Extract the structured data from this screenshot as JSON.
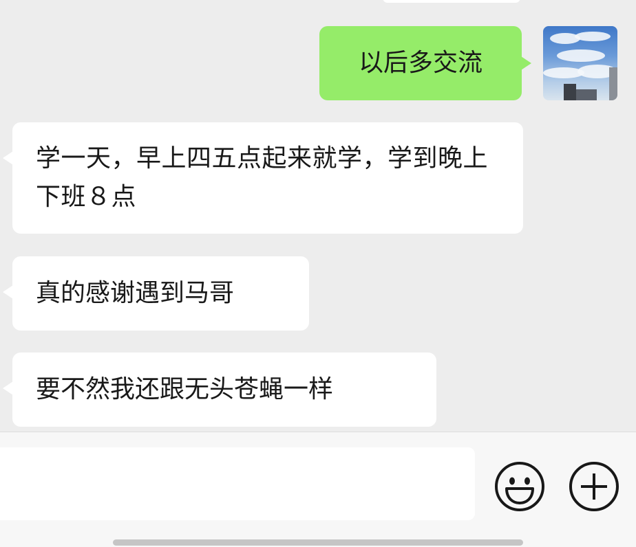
{
  "chat": {
    "messages": [
      {
        "direction": "outgoing",
        "text": "以后多交流"
      },
      {
        "direction": "incoming",
        "text": "学一天，早上四五点起来就学，学到晚上下班８点"
      },
      {
        "direction": "incoming",
        "text": "真的感谢遇到马哥"
      },
      {
        "direction": "incoming",
        "text": "要不然我还跟无头苍蝇一样"
      }
    ],
    "colors": {
      "outgoing_bubble": "#95ec69",
      "incoming_bubble": "#ffffff",
      "background": "#ededed"
    }
  },
  "input_bar": {
    "message_value": "",
    "icons": [
      "emoji-icon",
      "plus-icon"
    ]
  }
}
